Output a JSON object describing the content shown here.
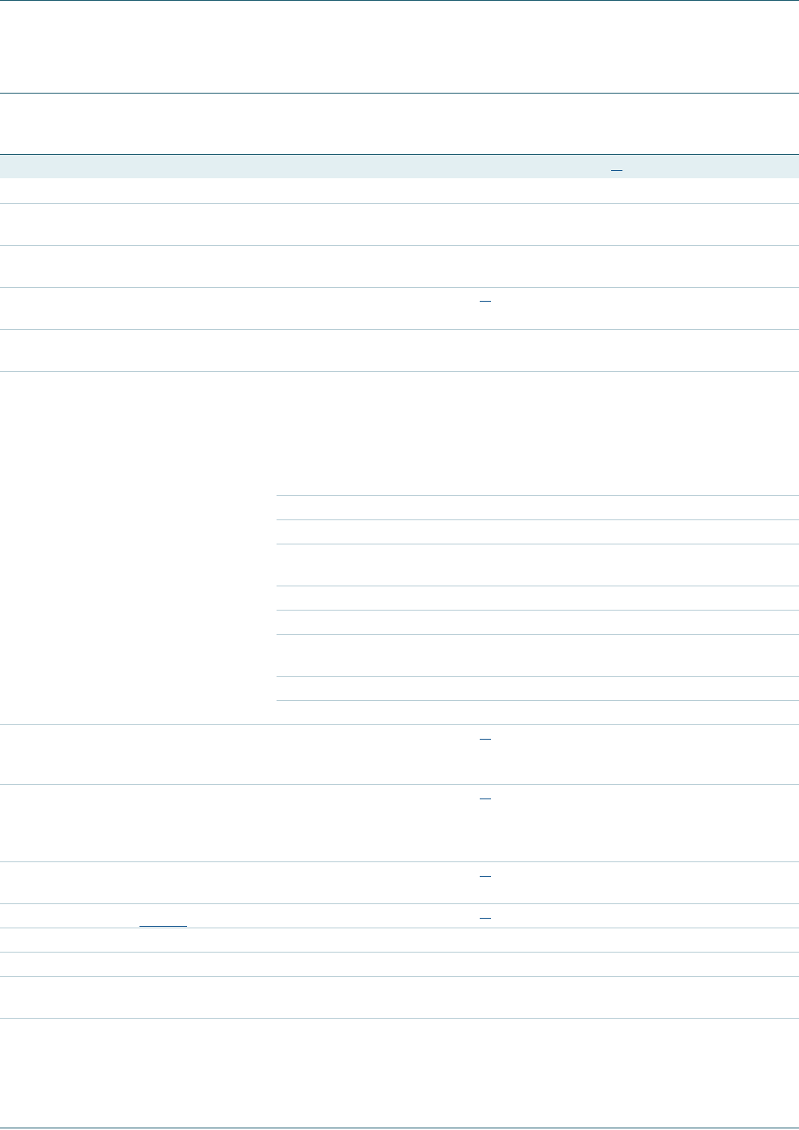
{
  "document": {
    "title": "",
    "header_band_label": "",
    "table_rows": [],
    "colors": {
      "rule_dark": "#1a5a6e",
      "rule_light": "#b6ccd4",
      "header_band": "#e3eff2",
      "link": "#0b4f8a"
    }
  }
}
